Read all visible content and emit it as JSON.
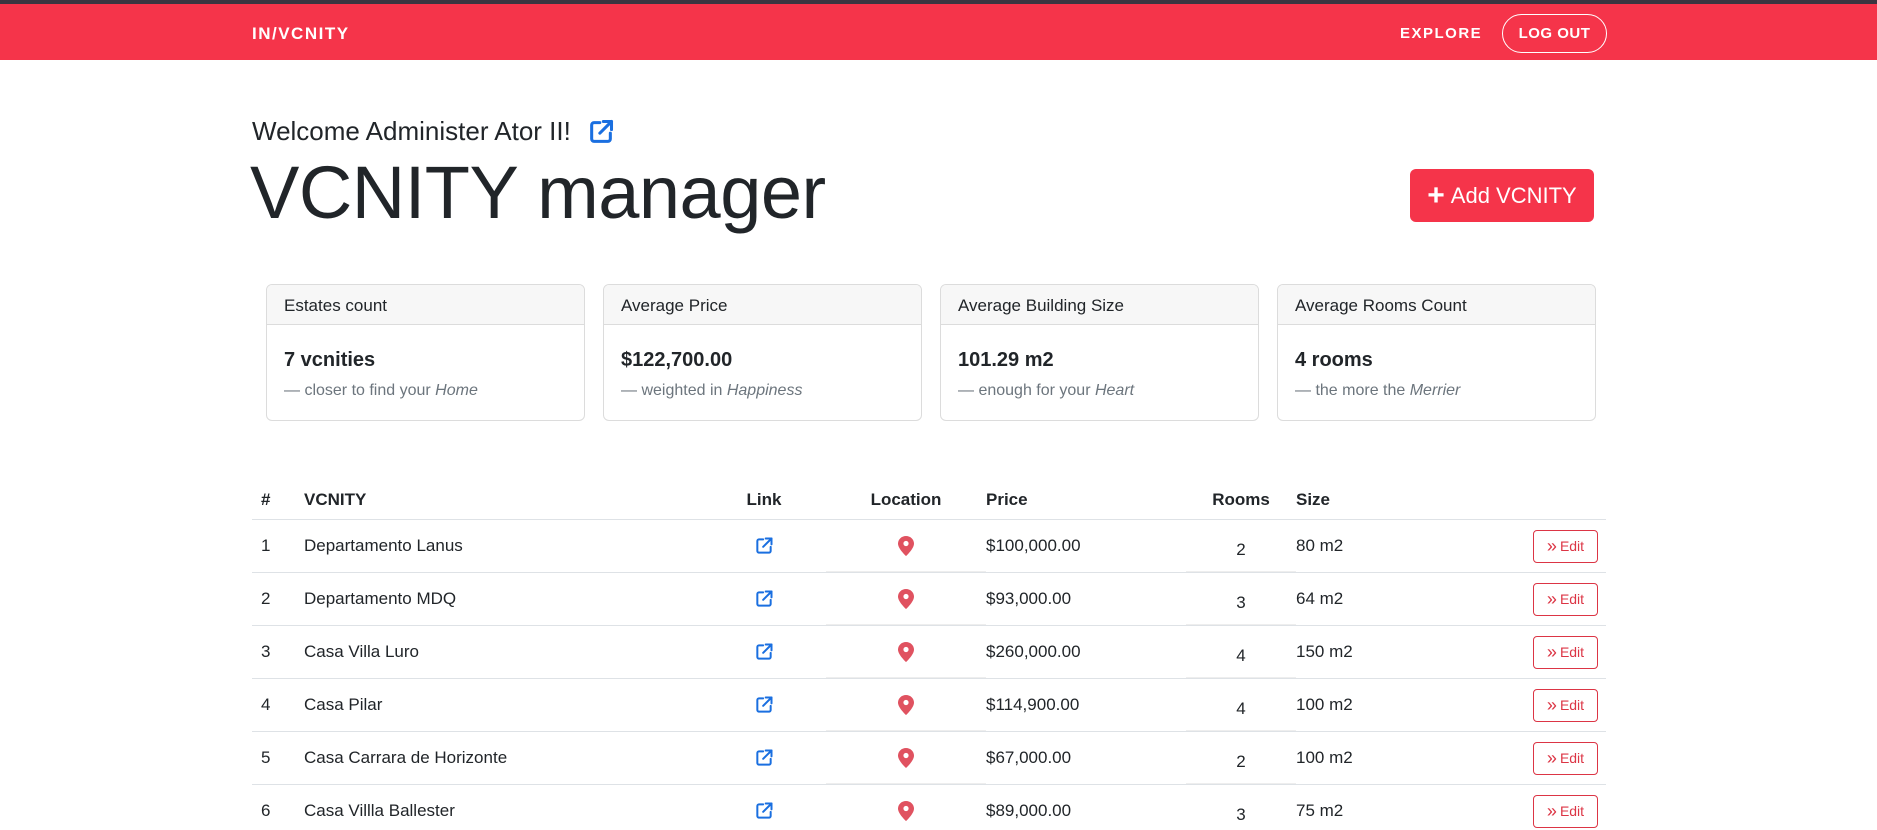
{
  "nav": {
    "brand": "IN/VCNITY",
    "explore": "EXPLORE",
    "logout": "LOG OUT"
  },
  "header": {
    "welcome": "Welcome Administer Ator II!",
    "title": "VCNITY manager",
    "add_button": "Add VCNITY",
    "add_plus": "+"
  },
  "stats": [
    {
      "title": "Estates count",
      "value": "7 vcnities",
      "sub_prefix": "— closer to find your ",
      "sub_em": "Home"
    },
    {
      "title": "Average Price",
      "value": "$122,700.00",
      "sub_prefix": "— weighted in ",
      "sub_em": "Happiness"
    },
    {
      "title": "Average Building Size",
      "value": "101.29 m2",
      "sub_prefix": "— enough for your ",
      "sub_em": "Heart"
    },
    {
      "title": "Average Rooms Count",
      "value": "4 rooms",
      "sub_prefix": "— the more the ",
      "sub_em": "Merrier"
    }
  ],
  "table": {
    "headers": {
      "num": "#",
      "name": "VCNITY",
      "link": "Link",
      "location": "Location",
      "price": "Price",
      "rooms": "Rooms",
      "size": "Size"
    },
    "edit_label": "Edit",
    "edit_chev": "»",
    "rows": [
      {
        "num": "1",
        "name": "Departamento Lanus",
        "price": "$100,000.00",
        "rooms": "2",
        "size": "80 m2"
      },
      {
        "num": "2",
        "name": "Departamento MDQ",
        "price": "$93,000.00",
        "rooms": "3",
        "size": "64 m2"
      },
      {
        "num": "3",
        "name": "Casa Villa Luro",
        "price": "$260,000.00",
        "rooms": "4",
        "size": "150 m2"
      },
      {
        "num": "4",
        "name": "Casa Pilar",
        "price": "$114,900.00",
        "rooms": "4",
        "size": "100 m2"
      },
      {
        "num": "5",
        "name": "Casa Carrara de Horizonte",
        "price": "$67,000.00",
        "rooms": "2",
        "size": "100 m2"
      },
      {
        "num": "6",
        "name": "Casa Villla Ballester",
        "price": "$89,000.00",
        "rooms": "3",
        "size": "75 m2"
      }
    ]
  },
  "colors": {
    "brand_red": "#f5344a",
    "link_blue": "#1a6fe0",
    "pin_red": "#e05260",
    "edit_red": "#dc3545"
  },
  "icons": {
    "external_link": "external-link-icon",
    "location_pin": "map-pin-icon",
    "plus": "plus-icon",
    "chevrons": "double-chevron-right-icon"
  }
}
